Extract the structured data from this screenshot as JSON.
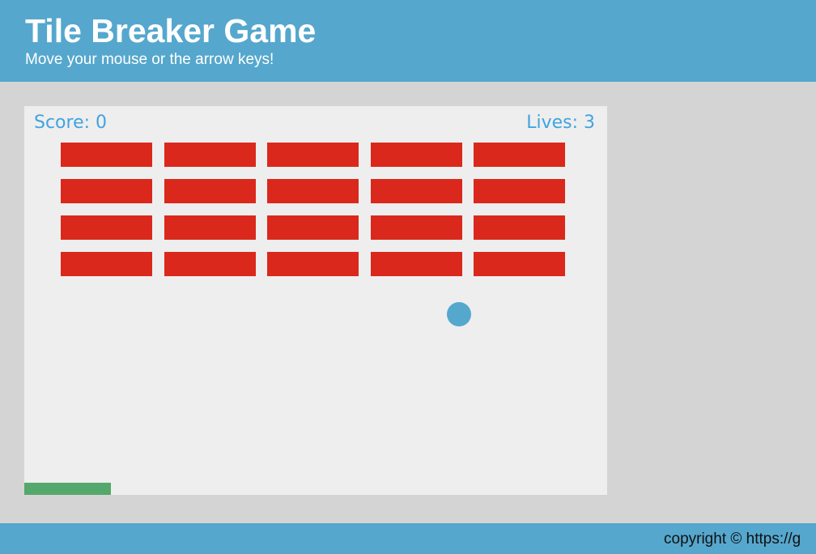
{
  "header": {
    "title": "Tile Breaker Game",
    "subtitle": "Move your mouse or the arrow keys!"
  },
  "game": {
    "score_label": "Score: ",
    "score": "0",
    "lives_label": "Lives: ",
    "lives": "3",
    "brick_rows": 4,
    "brick_columns": 5,
    "colors": {
      "background": "#eeeeee",
      "brick": "#da291c",
      "ball": "#55a7cd",
      "paddle": "#55a86b",
      "hud_text": "#3fa4df"
    }
  },
  "footer": {
    "copyright": "copyright © https://g"
  }
}
